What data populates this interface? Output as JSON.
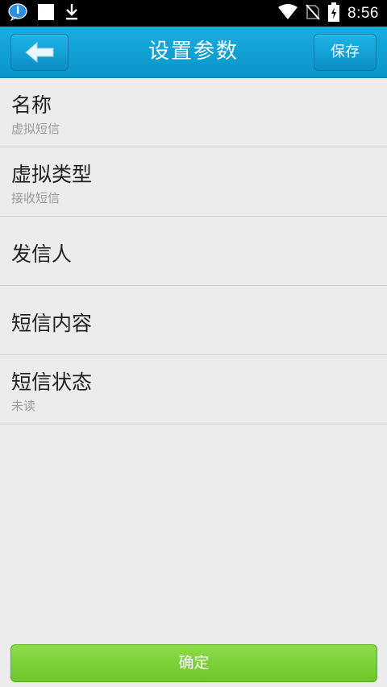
{
  "status_bar": {
    "time": "8:56",
    "icons": [
      "chat-bubble-icon",
      "white-square-icon",
      "download-icon",
      "wifi-icon",
      "no-sim-icon",
      "battery-charging-icon"
    ]
  },
  "header": {
    "title": "设置参数",
    "save_label": "保存"
  },
  "settings": [
    {
      "label": "名称",
      "value": "虚拟短信"
    },
    {
      "label": "虚拟类型",
      "value": "接收短信"
    },
    {
      "label": "发信人",
      "value": ""
    },
    {
      "label": "短信内容",
      "value": ""
    },
    {
      "label": "短信状态",
      "value": "未读"
    }
  ],
  "footer": {
    "confirm_label": "确定"
  },
  "colors": {
    "header": "#0a94c9",
    "confirm": "#6cc72a",
    "background": "#ececec"
  }
}
